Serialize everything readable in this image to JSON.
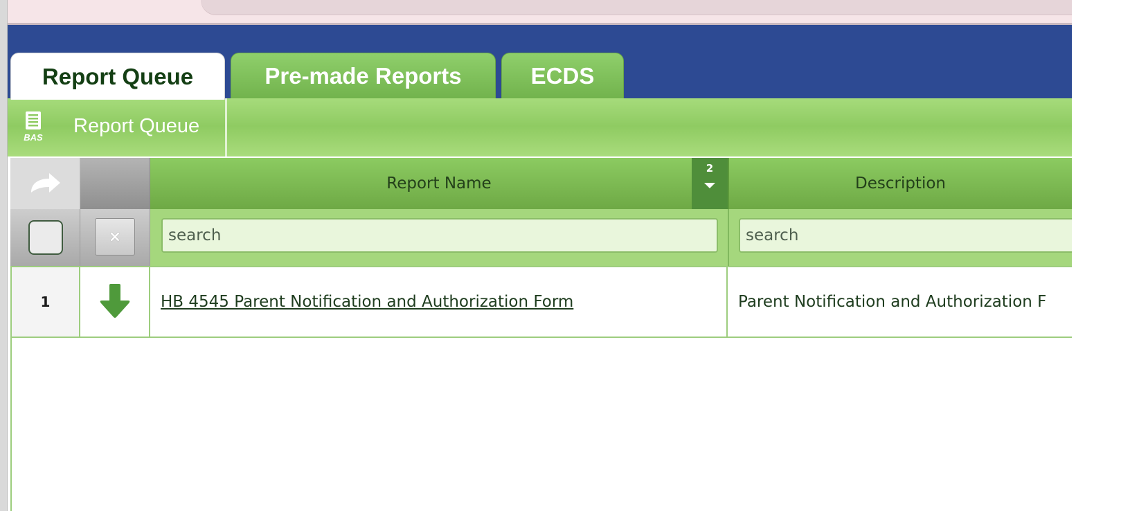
{
  "tabs": [
    {
      "label": "Report Queue",
      "active": true
    },
    {
      "label": "Pre-made Reports",
      "active": false
    },
    {
      "label": "ECDS",
      "active": false
    }
  ],
  "subbar": {
    "icon": "report-list-icon",
    "icon_caption": "BAS",
    "title": "Report Queue"
  },
  "table": {
    "header": {
      "share_icon": "share-arrow-icon",
      "report_name": "Report Name",
      "sort_order": "2",
      "description": "Description"
    },
    "search": {
      "report_placeholder": "search",
      "description_placeholder": "search",
      "clear_icon": "×"
    },
    "rows": [
      {
        "number": "1",
        "icon": "download-arrow-icon",
        "report_name": "HB 4545 Parent Notification and Authorization Form",
        "description": "Parent Notification and Authorization F"
      }
    ]
  },
  "colors": {
    "header_blue": "#2d4a93",
    "tab_green": "#7fc25a",
    "bar_green": "#9bd36f",
    "text_dark_green": "#143f14"
  }
}
